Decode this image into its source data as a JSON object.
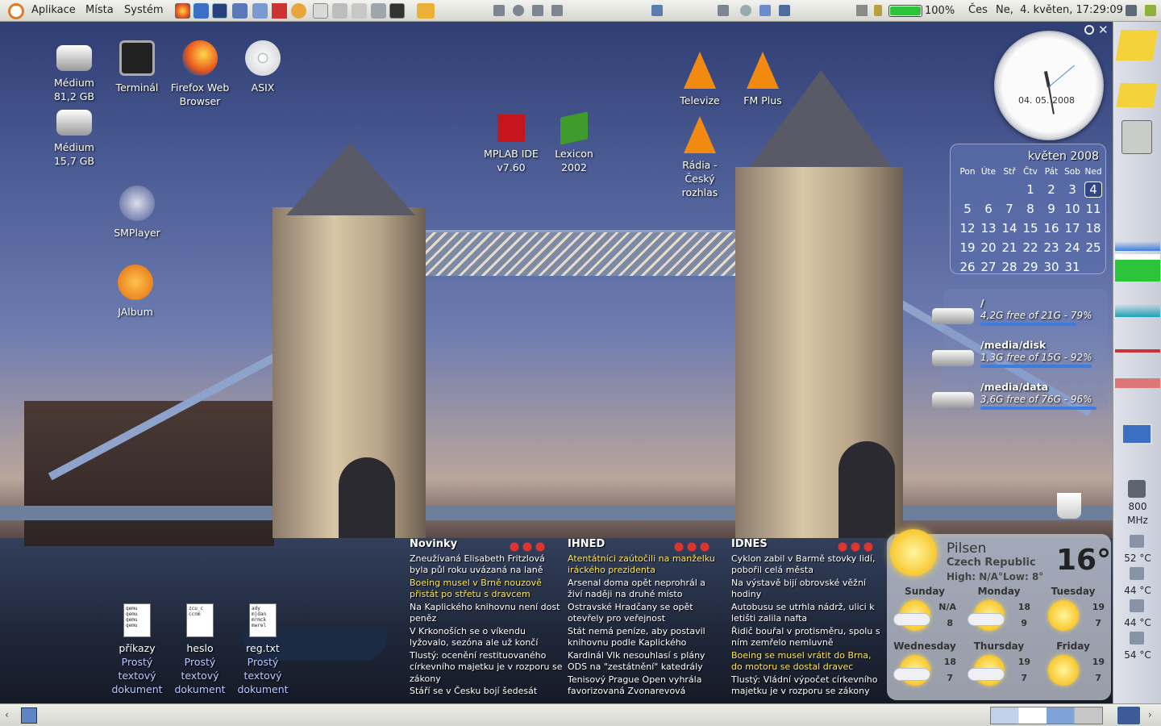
{
  "top_panel": {
    "menus": [
      "Aplikace",
      "Místa",
      "Systém"
    ],
    "battery_percent": "100%",
    "keyboard_layout": "Čes",
    "datetime": "Ne,  4. květen, 17:29:09",
    "battery_level": 1.0
  },
  "desktop_icons": [
    {
      "label": "Médium 81,2 GB",
      "icon": "harddisk-icon"
    },
    {
      "label": "Terminál",
      "icon": "terminal-icon"
    },
    {
      "label": "Firefox Web Browser",
      "icon": "firefox-icon"
    },
    {
      "label": "ASIX",
      "icon": "cd-icon"
    },
    {
      "label": "Médium 15,7 GB",
      "icon": "harddisk-icon"
    },
    {
      "label": "SMPlayer",
      "icon": "smplayer-icon"
    },
    {
      "label": "JAlbum",
      "icon": "jalbum-icon"
    },
    {
      "label": "MPLAB IDE v7.60",
      "icon": "mplab-icon"
    },
    {
      "label": "Lexicon 2002",
      "icon": "book-icon"
    },
    {
      "label": "Televize",
      "icon": "vlc-icon"
    },
    {
      "label": "FM Plus",
      "icon": "vlc-icon"
    },
    {
      "label": "Rádia - Český rozhlas",
      "icon": "vlc-icon"
    }
  ],
  "clock": {
    "date": "04. 05. 2008"
  },
  "calendar": {
    "title": "květen 2008",
    "weekdays": [
      "Pon",
      "Úte",
      "Stř",
      "Čtv",
      "Pát",
      "Sob",
      "Ned"
    ],
    "weeks": [
      [
        "",
        "",
        "",
        "1",
        "2",
        "3",
        "4"
      ],
      [
        "5",
        "6",
        "7",
        "8",
        "9",
        "10",
        "11"
      ],
      [
        "12",
        "13",
        "14",
        "15",
        "16",
        "17",
        "18"
      ],
      [
        "19",
        "20",
        "21",
        "22",
        "23",
        "24",
        "25"
      ],
      [
        "26",
        "27",
        "28",
        "29",
        "30",
        "31",
        ""
      ]
    ],
    "today": "4"
  },
  "disks": [
    {
      "path": "/",
      "info": "4,2G free of 21G - 79%",
      "usage": 0.79
    },
    {
      "path": "/media/disk",
      "info": "1,3G free of 15G - 92%",
      "usage": 0.92
    },
    {
      "path": "/media/data",
      "info": "3,6G free of 76G - 96%",
      "usage": 0.96
    }
  ],
  "dock": {
    "cpu_freq": "800",
    "cpu_unit": "MHz",
    "temps": [
      "52 °C",
      "44 °C",
      "44 °C",
      "54 °C"
    ]
  },
  "news": [
    {
      "source": "Novinky",
      "items": [
        {
          "text": "Zneužívaná Elisabeth Fritzlová byla půl roku uvázaná na laně",
          "hl": false
        },
        {
          "text": "Boeing musel v Brně nouzově přistát po střetu s dravcem",
          "hl": true
        },
        {
          "text": "Na Kaplického knihovnu není dost peněz",
          "hl": false
        },
        {
          "text": "V Krkonoších se o víkendu lyžovalo, sezóna ale už končí",
          "hl": false
        },
        {
          "text": "Tlustý: ocenění restituovaného církevního majetku je v rozporu se zákony",
          "hl": false
        },
        {
          "text": "Stáří se v Česku bojí šedesát",
          "hl": false
        }
      ]
    },
    {
      "source": "IHNED",
      "items": [
        {
          "text": "Atentátníci zaútočili na manželku iráckého prezidenta",
          "hl": true
        },
        {
          "text": "Arsenal doma opět neprohrál a živí naději na druhé místo",
          "hl": false
        },
        {
          "text": "Ostravské Hradčany se opět otevřely pro veřejnost",
          "hl": false
        },
        {
          "text": "Stát nemá peníze, aby postavil knihovnu podle Kaplického",
          "hl": false
        },
        {
          "text": "Kardinál Vlk nesouhlasí s plány ODS na \"zestátnění\" katedrály",
          "hl": false
        },
        {
          "text": "Tenisový Prague Open vyhrála favorizovaná Zvonarevová",
          "hl": false
        }
      ]
    },
    {
      "source": "IDNES",
      "items": [
        {
          "text": "Cyklon zabil v Barmě stovky lidí, pobořil celá města",
          "hl": false
        },
        {
          "text": "Na výstavě bijí obrovské věžní hodiny",
          "hl": false
        },
        {
          "text": "Autobusu se utrhla nádrž, ulici k letišti zalila nafta",
          "hl": false
        },
        {
          "text": "Řidič bouřal v protisměru, spolu s ním zemřelo nemluvně",
          "hl": false
        },
        {
          "text": "Boeing se musel vrátit do Brna, do motoru se dostal dravec",
          "hl": true
        },
        {
          "text": "Tlustý: Vládní výpočet církevního majetku je v rozporu se zákony",
          "hl": false
        }
      ]
    }
  ],
  "weather": {
    "city": "Pilsen",
    "country": "Czech Republic",
    "high": "High: N/A°",
    "low": "Low: 8°",
    "temp": "16°",
    "days": [
      {
        "name": "Sunday",
        "hi": "N/A",
        "lo": "8",
        "icon": "partly-cloudy-icon"
      },
      {
        "name": "Monday",
        "hi": "18",
        "lo": "9",
        "icon": "partly-cloudy-icon"
      },
      {
        "name": "Tuesday",
        "hi": "19",
        "lo": "7",
        "icon": "sunny-icon"
      },
      {
        "name": "Wednesday",
        "hi": "18",
        "lo": "7",
        "icon": "partly-cloudy-icon"
      },
      {
        "name": "Thursday",
        "hi": "19",
        "lo": "7",
        "icon": "partly-cloudy-icon"
      },
      {
        "name": "Friday",
        "hi": "19",
        "lo": "7",
        "icon": "sunny-icon"
      }
    ]
  },
  "file_icons": [
    {
      "name": "příkazy",
      "type": "Prostý textový dokument",
      "preview": "qemu qemu qemu qemu"
    },
    {
      "name": "heslo",
      "type": "Prostý textový dokument",
      "preview": "zcu_c ccnm"
    },
    {
      "name": "reg.txt",
      "type": "Prostý textový dokument",
      "preview": "ady mjdan mrmck mwrel"
    }
  ],
  "colors": {
    "panel": "#e4e4df",
    "accent": "#3d7de0",
    "highlight": "#ffe65a",
    "battery": "#2cc43a"
  }
}
